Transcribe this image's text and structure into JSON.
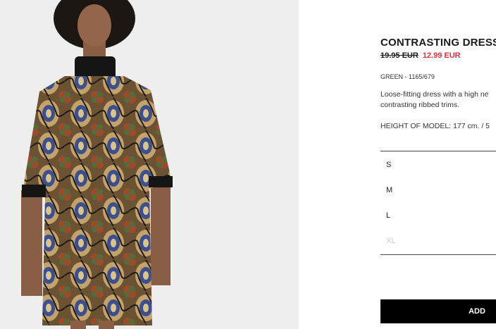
{
  "product": {
    "title": "CONTRASTING DRESS",
    "old_price": "19.95 EUR",
    "new_price": "12.99 EUR",
    "reference": "GREEN - 1165/679",
    "description": "Loose-fitting dress with a high ne contrasting ribbed trims.",
    "model_height": "HEIGHT OF MODEL: 177 cm. / 5"
  },
  "sizes": [
    {
      "label": "S",
      "available": true
    },
    {
      "label": "M",
      "available": true
    },
    {
      "label": "L",
      "available": true
    },
    {
      "label": "XL",
      "available": false
    }
  ],
  "add_button": {
    "label": "ADD"
  },
  "colors": {
    "sale_red": "#e4313b",
    "button_black": "#000000"
  }
}
